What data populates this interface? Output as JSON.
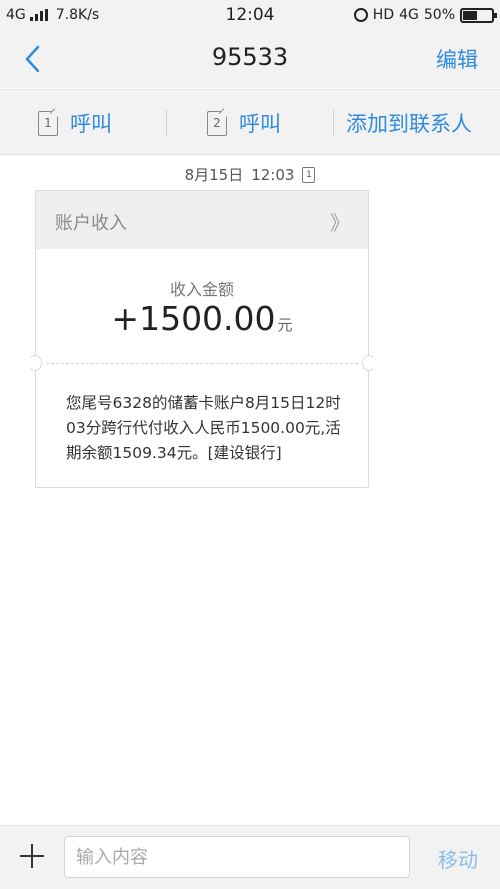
{
  "status_bar": {
    "network": "4G",
    "speed": "7.8K/s",
    "time": "12:04",
    "hd_label": "HD",
    "network_right": "4G",
    "battery": "50%",
    "battery_level": 0.5
  },
  "nav": {
    "title": "95533",
    "edit_label": "编辑"
  },
  "actions": {
    "call1_sim": "1",
    "call1_label": "呼叫",
    "call2_sim": "2",
    "call2_label": "呼叫",
    "add_contact_label": "添加到联系人"
  },
  "message_meta": {
    "date": "8月15日",
    "time": "12:03",
    "sim": "1"
  },
  "card": {
    "title": "账户收入",
    "arrow": "》",
    "amount_label": "收入金额",
    "amount": "+1500.00",
    "amount_unit": "元",
    "body": "您尾号6328的储蓄卡账户8月15日12时03分跨行代付收入人民币1500.00元,活期余额1509.34元。[建设银行]"
  },
  "composer": {
    "placeholder": "输入内容",
    "send_label": "移动"
  }
}
